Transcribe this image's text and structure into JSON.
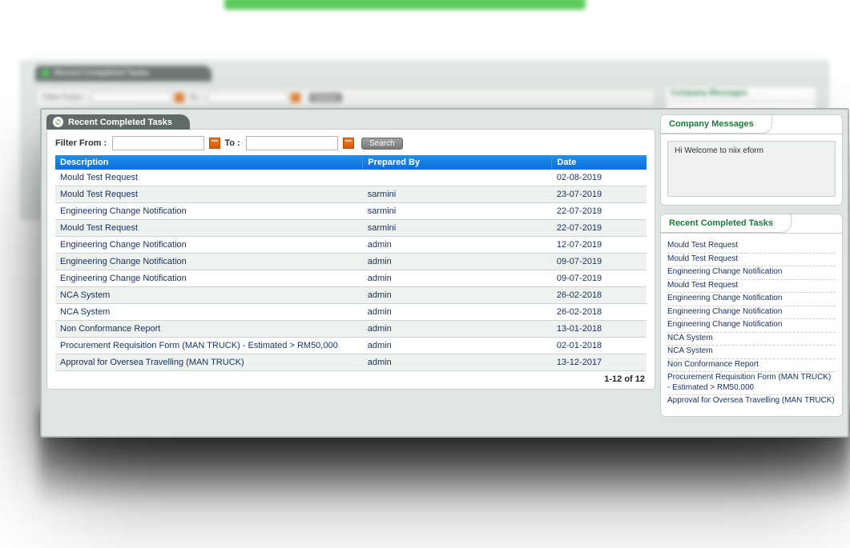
{
  "panel": {
    "title": "Recent Completed Tasks"
  },
  "filter": {
    "from_label": "Filter From :",
    "to_label": "To :",
    "from_value": "",
    "to_value": "",
    "search_label": "Search"
  },
  "columns": {
    "description": "Description",
    "prepared_by": "Prepared By",
    "date": "Date"
  },
  "rows": [
    {
      "description": "Mould Test Request",
      "prepared_by": "",
      "date": "02-08-2019"
    },
    {
      "description": "Mould Test Request",
      "prepared_by": "sarmini",
      "date": "23-07-2019"
    },
    {
      "description": "Engineering Change Notification",
      "prepared_by": "sarmini",
      "date": "22-07-2019"
    },
    {
      "description": "Mould Test Request",
      "prepared_by": "sarmini",
      "date": "22-07-2019"
    },
    {
      "description": "Engineering Change Notification",
      "prepared_by": "admin",
      "date": "12-07-2019"
    },
    {
      "description": "Engineering Change Notification",
      "prepared_by": "admin",
      "date": "09-07-2019"
    },
    {
      "description": "Engineering Change Notification",
      "prepared_by": "admin",
      "date": "09-07-2019"
    },
    {
      "description": "NCA System",
      "prepared_by": "admin",
      "date": "26-02-2018"
    },
    {
      "description": "NCA System",
      "prepared_by": "admin",
      "date": "26-02-2018"
    },
    {
      "description": "Non Conformance Report",
      "prepared_by": "admin",
      "date": "13-01-2018"
    },
    {
      "description": "Procurement Requisition Form (MAN TRUCK) - Estimated > RM50,000",
      "prepared_by": "admin",
      "date": "02-01-2018"
    },
    {
      "description": "Approval for Oversea Travelling (MAN TRUCK)",
      "prepared_by": "admin",
      "date": "13-12-2017"
    }
  ],
  "pager": {
    "text": "1-12 of 12"
  },
  "sidebar": {
    "messages": {
      "title": "Company Messages",
      "body": "Hi Welcome to niix eform"
    },
    "recent": {
      "title": "Recent Completed Tasks",
      "items": [
        "Mould Test Request",
        "Mould Test Request",
        "Engineering Change Notification",
        "Mould Test Request",
        "Engineering Change Notification",
        "Engineering Change Notification",
        "Engineering Change Notification",
        "NCA System",
        "NCA System",
        "Non Conformance Report",
        "Procurement Requisition Form (MAN TRUCK) - Estimated > RM50,000",
        "Approval for Oversea Travelling (MAN TRUCK)"
      ]
    }
  },
  "back": {
    "panel_title": "Recent Completed Tasks",
    "filter_from": "Filter From :",
    "filter_to": "To :",
    "search": "Search",
    "side_title": "Company Messages"
  }
}
